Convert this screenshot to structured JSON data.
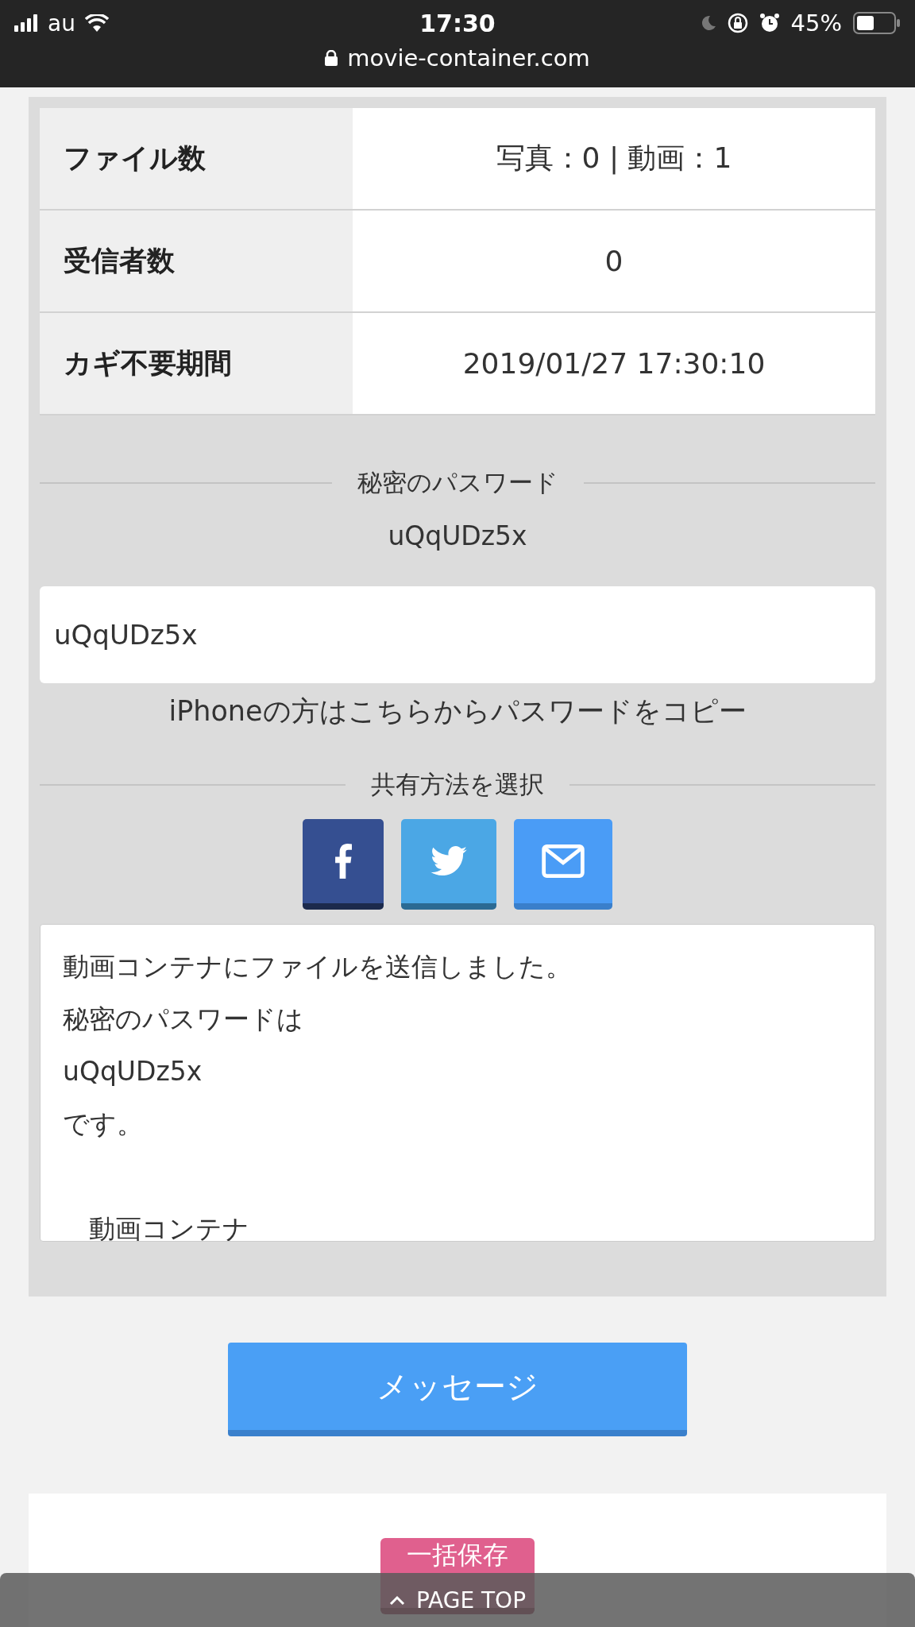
{
  "status_bar": {
    "carrier": "au",
    "time": "17:30",
    "battery": "45%",
    "url": "movie-container.com"
  },
  "table": {
    "rows": [
      {
        "label": "ファイル数",
        "value": "写真：0 | 動画：1"
      },
      {
        "label": "受信者数",
        "value": "0"
      },
      {
        "label": "カギ不要期間",
        "value": "2019/01/27 17:30:10"
      }
    ]
  },
  "password_section": {
    "heading": "秘密のパスワード",
    "password": "uQqUDz5x",
    "field_value": "uQqUDz5x",
    "copy_link": "iPhoneの方はこちらからパスワードをコピー"
  },
  "share_section": {
    "heading": "共有方法を選択",
    "buttons": [
      {
        "kind": "facebook"
      },
      {
        "kind": "twitter"
      },
      {
        "kind": "mail"
      }
    ]
  },
  "message_box": {
    "lines": [
      {
        "kind": "text",
        "text": "動画コンテナにファイルを送信しました。"
      },
      {
        "kind": "text",
        "text": "秘密のパスワードは"
      },
      {
        "kind": "text",
        "text": "uQqUDz5x"
      },
      {
        "kind": "text",
        "text": "です。"
      },
      {
        "kind": "blank"
      },
      {
        "kind": "text",
        "text": "　動画コンテナ"
      }
    ]
  },
  "message_button": "メッセージ",
  "save_button": "一括保存",
  "page_top": "PAGE TOP"
}
